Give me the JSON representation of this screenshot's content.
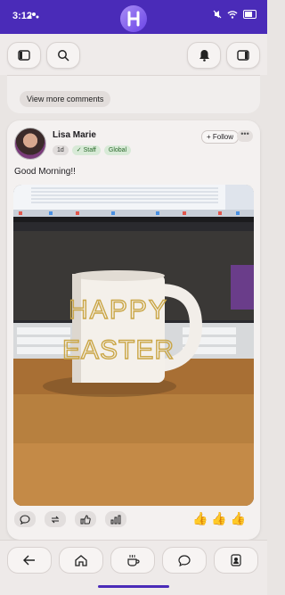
{
  "status": {
    "time": "3:12"
  },
  "prev_card": {
    "view_more": "View more comments"
  },
  "post": {
    "author": "Lisa Marie",
    "age": "1d",
    "staff_badge": "✓ Staff",
    "audience": "Global",
    "follow_label": "+ Follow",
    "more_label": "•••",
    "text": "Good Morning!!"
  },
  "photo": {
    "mug_text_line1": "HAPPY",
    "mug_text_line2": "EASTER"
  },
  "reactions": {
    "thumbs": "👍 👍 👍"
  },
  "colors": {
    "accent": "#4a2bb8",
    "staff_green": "#2c6b2d"
  }
}
